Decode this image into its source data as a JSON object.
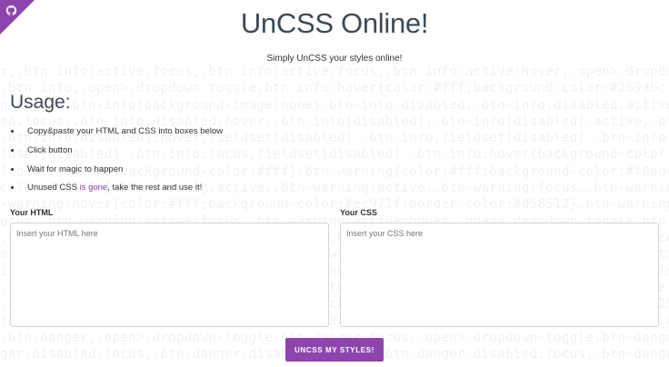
{
  "header": {
    "title": "UnCSS Online!",
    "subtitle": "Simply UnCSS your styles online!"
  },
  "corner_badge": {
    "icon": "github-octocat-icon",
    "color": "#8e44ad"
  },
  "usage": {
    "heading": "Usage:",
    "steps": [
      {
        "text": "Copy&paste your HTML and CSS into boxes below"
      },
      {
        "text": "Click button"
      },
      {
        "text": "Wait for magic to happen"
      },
      {
        "before": "Unused CSS ",
        "link": "is gone",
        "after": ", take the rest and use it!"
      }
    ]
  },
  "form": {
    "html_label": "Your HTML",
    "html_placeholder": "Insert your HTML here",
    "css_label": "Your CSS",
    "css_placeholder": "Insert your CSS here",
    "submit_label": "UNCSS MY STYLES!"
  },
  "colors": {
    "accent": "#8e44ad",
    "title_text": "#3d4a57",
    "background_code_text": "#f1f1f1"
  },
  "background_code": [
    "r,.btn-info:active.focus,.btn-info:active:focus,.btn-info:active:hover,.open>.dropdown-toggle",
    ".btn-info,.open>.dropdown-toggle.btn-info:hover{color:#fff;background-color:#269abc;border-",
    "n-toggle.btn-info{background-image:none}.btn-info.disabled,.btn-info.disabled.active,.btn-",
    "ed.focus,.btn-info.disabled:hover,.btn-info[disabled],.btn-info[disabled].active,.btn-info",
    ".btn-info[disabled]:hover,fieldset[disabled] .btn-info,fieldset[disabled] .btn-info.active",
    "ldset[disabled] .btn-info:focus,fieldset[disabled] .btn-info:hover{background-color:#5bc0de",
    "{color:#5bc0de;background-color:#fff}.btn-warning{color:#fff;background-color:#f0ad4e;border-",
    "color:#985f0d}.btn-warning.active,.btn-warning:active,.btn-warning:focus,.btn-warning",
    "-warning:hover{color:#fff;background-color:#ec971f;border-color:#d58512}.btn-warning.active",
    "ocus,.btn-warning:active:focus,.btn-warning:active:hover,.open>.dropdown-toggle.btn-warning",
    ".btn-warning:focus,.open>.dropdown-toggle.btn-warning:hover{color:#fff;background-color:#d58",
    "e.btn-warning{background-image:none}.btn-warning.disabled,.btn-warning.disabled.active,.btn-",
    "ing.disabled:focus,.btn-warning.disabled:hover,.btn-warning[disabled],.btn-warning[disabled]",
    ".btn-danger:active:hover,.open>.dropdown-toggle.btn-danger:focus,.btn-danger:active",
    ".dropdown-toggle.btn-danger{color:#fff;background-color:#c9302c;border-color:#ac2925}.btn-",
    ":hover,.btn-danger:active.focus,.btn-danger:active:focus,.btn-danger:active:hover,.open>",
    ".btn-danger,.open>.dropdown-toggle.btn-danger:focus,.open>.dropdown-toggle.btn-danger:hover",
    "ger.disabled.focus,.btn-danger.disabled:active,.btn-danger.disabled:focus,.btn-danger"
  ]
}
